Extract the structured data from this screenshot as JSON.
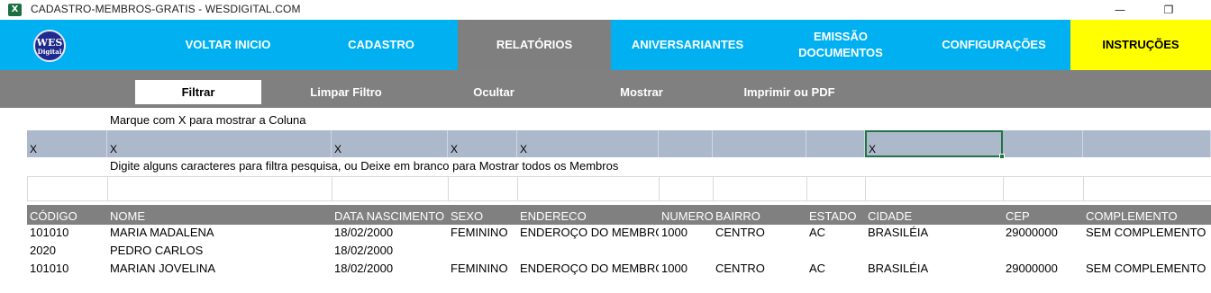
{
  "window": {
    "app_icon": "excel-icon",
    "title": "CADASTRO-MEMBROS-GRATIS - WESDIGITAL.COM",
    "minimize_glyph": "—",
    "restore_glyph": "❐"
  },
  "logo": {
    "line1": "WES",
    "line2": "Digital"
  },
  "nav": {
    "voltar": "VOLTAR INICIO",
    "cadastro": "CADASTRO",
    "relatorios": "RELATÓRIOS",
    "aniversariantes": "ANIVERSARIANTES",
    "emissao_line1": "EMISSÃO",
    "emissao_line2": "DOCUMENTOS",
    "configuracoes": "CONFIGURAÇÕES",
    "instrucoes": "INSTRUÇÕES"
  },
  "toolbar": {
    "filtrar": "Filtrar",
    "limpar": "Limpar Filtro",
    "ocultar": "Ocultar",
    "mostrar": "Mostrar",
    "imprimir": "Imprimir ou PDF"
  },
  "sheet": {
    "instruction_columns": "Marque com X para mostrar a Coluna",
    "instruction_filter": "Digite alguns caracteres para filtra pesquisa, ou Deixe em branco para Mostrar todos os Membros",
    "column_marks": [
      "X",
      "X",
      "X",
      "X",
      "X",
      "",
      "",
      "",
      "X",
      "",
      ""
    ],
    "headers": [
      "CÓDIGO",
      "NOME",
      "DATA NASCIMENTO",
      "SEXO",
      "ENDERECO",
      "NUMERO",
      "BAIRRO",
      "ESTADO",
      "CIDADE",
      "CEP",
      "COMPLEMENTO"
    ],
    "rows": [
      [
        "101010",
        "MARIA MADALENA",
        "18/02/2000",
        "FEMININO",
        "ENDEROÇO DO MEMBRO",
        "1000",
        "CENTRO",
        "AC",
        "BRASILÉIA",
        "29000000",
        "SEM COMPLEMENTO"
      ],
      [
        "2020",
        "PEDRO CARLOS",
        "18/02/2000",
        "",
        "",
        "",
        "",
        "",
        "",
        "",
        ""
      ],
      [
        "101010",
        "MARIAN JOVELINA",
        "18/02/2000",
        "FEMININO",
        "ENDEROÇO DO MEMBRO",
        "1000",
        "CENTRO",
        "AC",
        "BRASILÉIA",
        "29000000",
        "SEM COMPLEMENTO"
      ]
    ]
  },
  "colors": {
    "nav_bg": "#00b0f0",
    "nav_active": "#7f7f7f",
    "instructions_bg": "#ffff00",
    "toolbar_bg": "#808080",
    "column_mark_bg": "#acb9ca",
    "selection": "#217346"
  }
}
